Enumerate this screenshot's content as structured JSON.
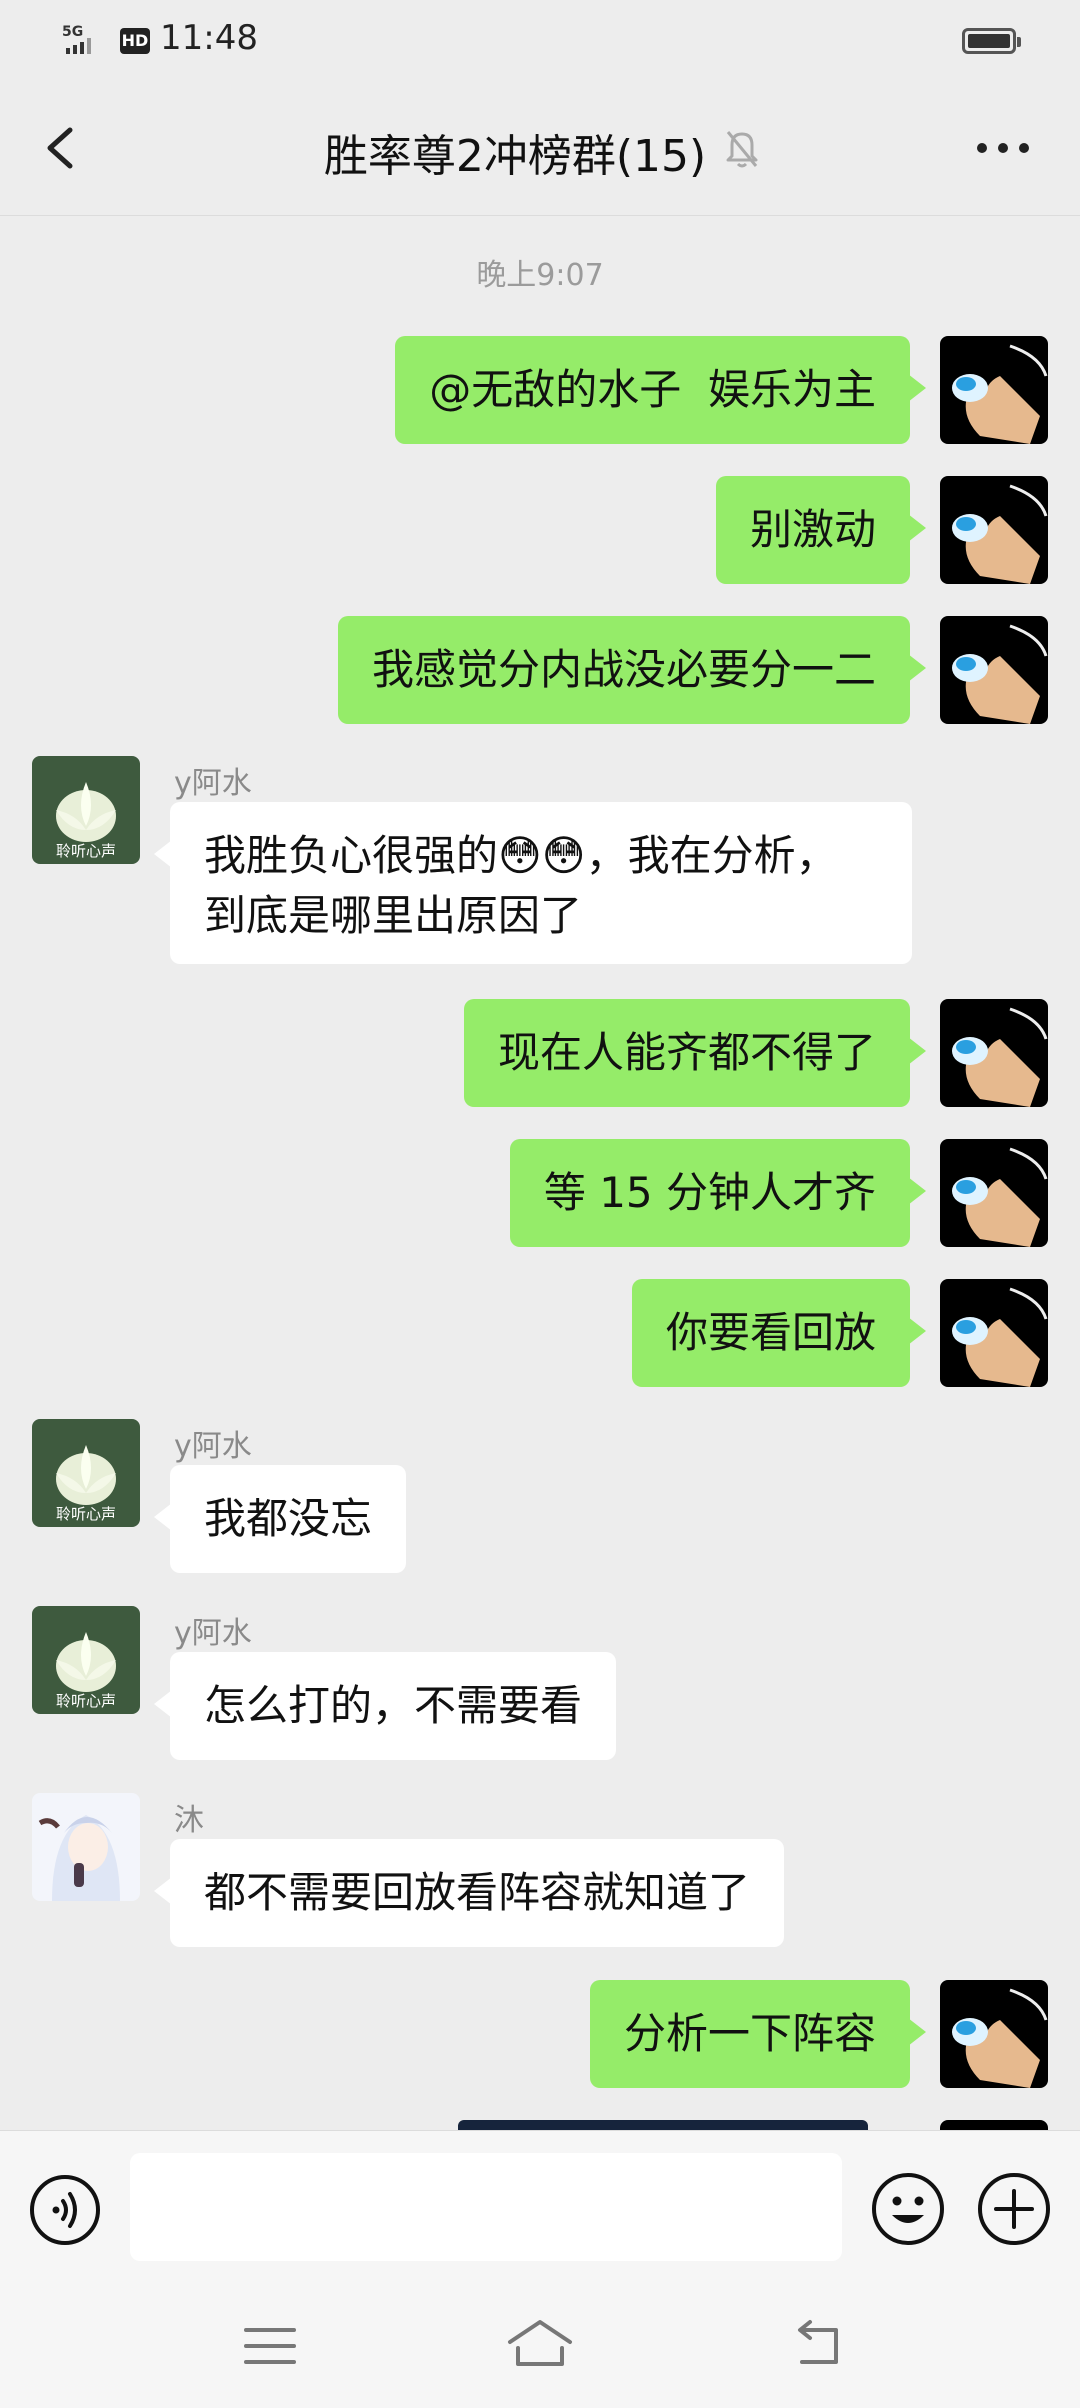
{
  "status_bar": {
    "network": "5G",
    "hd": "HD",
    "time": "11:48"
  },
  "header": {
    "title": "胜率尊2冲榜群(15)"
  },
  "chat": {
    "timestamp": "晚上9:07",
    "messages": [
      {
        "from": "me",
        "text": "@无敌的水子  娱乐为主"
      },
      {
        "from": "me",
        "text": "别激动"
      },
      {
        "from": "me",
        "text": "我感觉分内战没必要分一二"
      },
      {
        "from": "other",
        "sender": "y阿水",
        "avatar_label": "聆听心声",
        "text": "我胜负心很强的😳😳，我在分析，\n到底是哪里出原因了"
      },
      {
        "from": "me",
        "text": "现在人能齐都不得了"
      },
      {
        "from": "me",
        "text": "等 15 分钟人才齐"
      },
      {
        "from": "me",
        "text": "你要看回放"
      },
      {
        "from": "other",
        "sender": "y阿水",
        "avatar_label": "聆听心声",
        "text": "我都没忘"
      },
      {
        "from": "other",
        "sender": "y阿水",
        "avatar_label": "聆听心声",
        "text": "怎么打的，不需要看"
      },
      {
        "from": "other",
        "sender": "沐",
        "text": "都不需要回放看阵容就知道了"
      },
      {
        "from": "me",
        "text": "分析一下阵容"
      }
    ]
  },
  "input_bar": {
    "placeholder": ""
  },
  "icons": {
    "back": "chevron-left-icon",
    "mute": "bell-off-icon",
    "more": "more-dots-icon",
    "voice": "voice-icon",
    "emoji": "emoji-icon",
    "plus": "plus-icon"
  },
  "colors": {
    "my_bubble": "#95ec69",
    "other_bubble": "#ffffff",
    "background": "#ededed"
  }
}
